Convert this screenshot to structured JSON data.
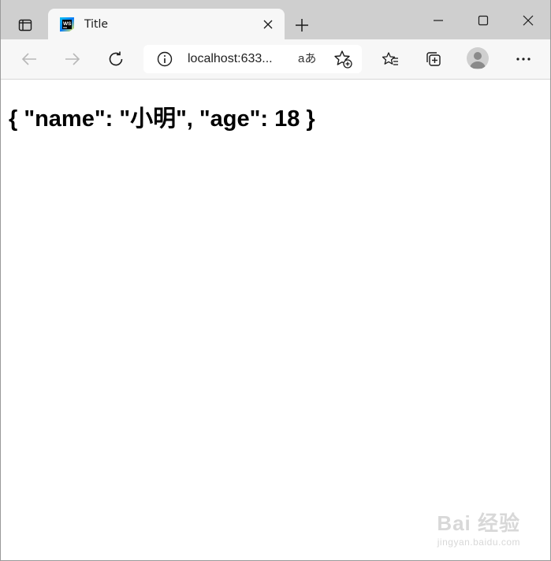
{
  "tab": {
    "title": "Title",
    "favicon": "webstorm-icon"
  },
  "address_bar": {
    "url": "localhost:633...",
    "read_aloud_label": "aあ"
  },
  "page": {
    "content": "{ \"name\": \"小明\", \"age\": 18 }"
  },
  "watermark": {
    "main": "Bai 经验",
    "sub": "jingyan.baidu.com"
  }
}
